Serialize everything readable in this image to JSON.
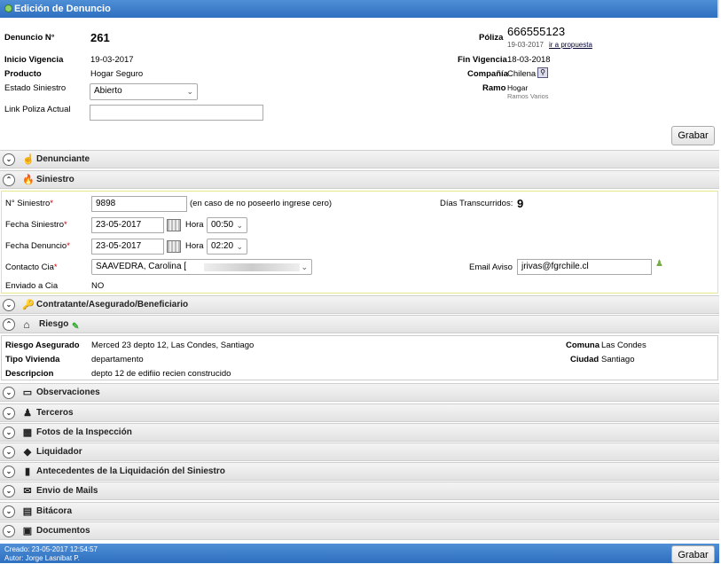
{
  "window": {
    "title": "Edición de Denuncio"
  },
  "header": {
    "denuncio_label": "Denuncio N°",
    "denuncio_value": "261",
    "inicio_label": "Inicio Vigencia",
    "inicio_value": "19-03-2017",
    "producto_label": "Producto",
    "producto_value": "Hogar Seguro",
    "estado_label": "Estado Siniestro",
    "estado_value": "Abierto",
    "link_label": "Link Poliza Actual",
    "link_value": "",
    "poliza_label": "Póliza",
    "poliza_value": "666555123",
    "poliza_date": "19-03-2017",
    "poliza_link": "ir a propuesta",
    "fin_label": "Fin Vigencia",
    "fin_value": "18-03-2018",
    "compania_label": "Compañía",
    "compania_value": "Chilena",
    "ramo_label": "Ramo",
    "ramo_value": "Hogar",
    "ramo_sub": "Ramos Varios",
    "grabar": "Grabar"
  },
  "sections": {
    "denunciante": "Denunciante",
    "siniestro": "Siniestro",
    "contratante": "Contratante/Asegurado/Beneficiario",
    "riesgo": "Riesgo",
    "observaciones": "Observaciones",
    "terceros": "Terceros",
    "fotos": "Fotos de la Inspección",
    "liquidador": "Liquidador",
    "antecedentes": "Antecedentes de la Liquidación del Siniestro",
    "envio": "Envio de Mails",
    "bitacora": "Bitácora",
    "documentos": "Documentos"
  },
  "siniestro": {
    "num_label": "N° Siniestro",
    "num_value": "9898",
    "num_hint": "(en caso de no poseerlo ingrese cero)",
    "dias_label": "Días Transcurridos:",
    "dias_value": "9",
    "fecha_siniestro_label": "Fecha Siniestro",
    "fecha_siniestro_value": "23-05-2017",
    "fecha_denuncio_label": "Fecha Denuncio",
    "fecha_denuncio_value": "23-05-2017",
    "hora_label": "Hora",
    "hora1": "00:50",
    "hora2": "02:20",
    "contacto_label": "Contacto Cia",
    "contacto_value": "SAAVEDRA, Carolina [",
    "email_label": "Email Aviso",
    "email_value": "jrivas@fgrchile.cl",
    "enviado_label": "Enviado a Cia",
    "enviado_value": "NO"
  },
  "riesgo": {
    "asegurado_label": "Riesgo Asegurado",
    "asegurado_value": "Merced 23 depto 12, Las Condes, Santiago",
    "tipo_label": "Tipo Vivienda",
    "tipo_value": "departamento",
    "desc_label": "Descripcion",
    "desc_value": "depto 12 de edifiio recien construcido",
    "comuna_label": "Comuna",
    "comuna_value": "Las Condes",
    "ciudad_label": "Ciudad",
    "ciudad_value": "Santiago"
  },
  "footer": {
    "creado": "Creado: 23-05-2017 12:54:57",
    "autor": "Autor: Jorge Lasnibat P.",
    "grabar": "Grabar"
  }
}
